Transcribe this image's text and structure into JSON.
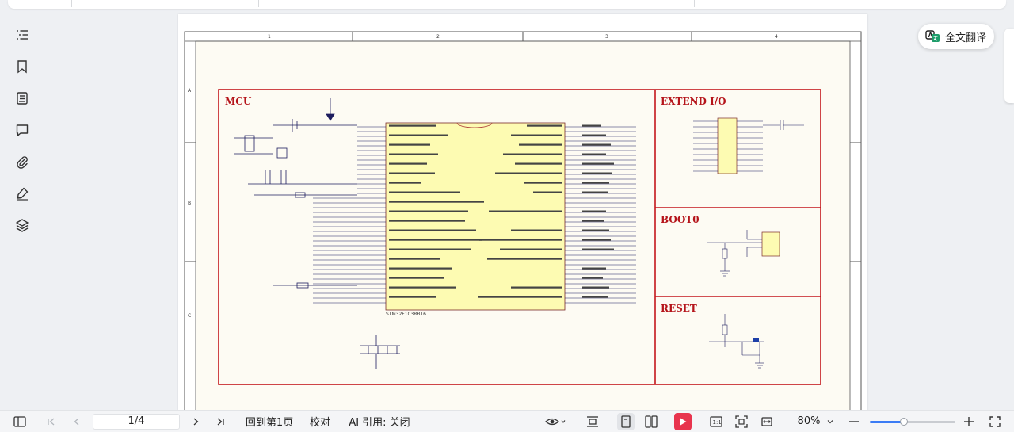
{
  "toolbar": {},
  "sidebar": {
    "items": [
      {
        "name": "outline-icon"
      },
      {
        "name": "bookmark-icon"
      },
      {
        "name": "notes-icon"
      },
      {
        "name": "comment-icon"
      },
      {
        "name": "attachment-icon"
      },
      {
        "name": "signature-icon"
      },
      {
        "name": "layers-icon"
      }
    ]
  },
  "translate": {
    "label": "全文翻译"
  },
  "schematic": {
    "border_cols": [
      "1",
      "2",
      "3",
      "4"
    ],
    "border_rows": [
      "A",
      "B",
      "C"
    ],
    "mcu": {
      "title": "MCU",
      "chip_name": "STM32F103RBT6"
    },
    "extend": {
      "title": "EXTEND I/O"
    },
    "boot": {
      "title": "BOOT0"
    },
    "reset": {
      "title": "RESET"
    },
    "colors": {
      "frame": "#c4161c",
      "chip_fill": "#fdfbb2",
      "paper": "#fdfbf3",
      "wire": "#1d1d5e"
    }
  },
  "bottombar": {
    "page_value": "1/4",
    "back_to_first": "回到第1页",
    "proofread": "校对",
    "ai_cite": "AI 引用: 关闭",
    "zoom": "80%",
    "zoom_fraction": 0.4
  }
}
